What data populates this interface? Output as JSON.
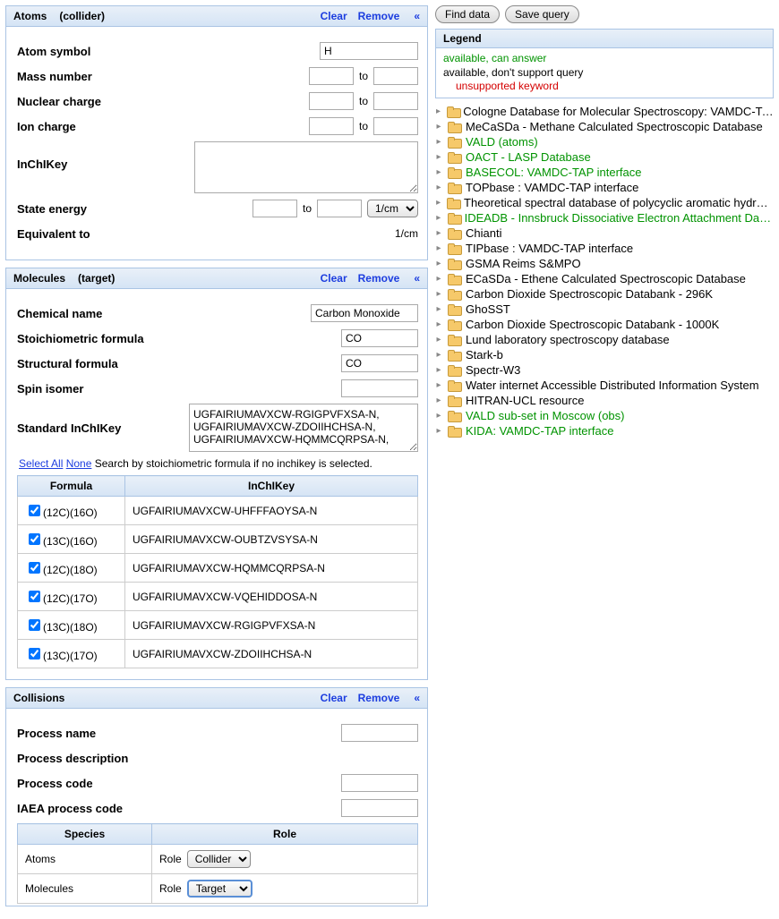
{
  "atoms": {
    "title": "Atoms",
    "subtitle": "(collider)",
    "clear": "Clear",
    "remove": "Remove",
    "collapse_glyph": "«",
    "fields": {
      "symbol_label": "Atom symbol",
      "symbol_value": "H",
      "mass_label": "Mass number",
      "nuclear_label": "Nuclear charge",
      "ion_label": "Ion charge",
      "inchi_label": "InChIKey",
      "state_label": "State energy",
      "to": "to",
      "unit_options": [
        "1/cm"
      ],
      "equivalent_label": "Equivalent to",
      "equivalent_unit": "1/cm"
    }
  },
  "molecules": {
    "title": "Molecules",
    "subtitle": "(target)",
    "clear": "Clear",
    "remove": "Remove",
    "collapse_glyph": "«",
    "fields": {
      "chem_label": "Chemical name",
      "chem_value": "Carbon Monoxide",
      "stoich_label": "Stoichiometric formula",
      "stoich_value": "CO",
      "struct_label": "Structural formula",
      "struct_value": "CO",
      "spin_label": "Spin isomer",
      "std_inchi_label": "Standard InChIKey",
      "std_inchi_value": "UGFAIRIUMAVXCW-RGIGPVFXSA-N,\nUGFAIRIUMAVXCW-ZDOIIHCHSA-N,\nUGFAIRIUMAVXCW-HQMMCQRPSA-N,"
    },
    "select_all": "Select All",
    "none": "None",
    "search_note": "Search by stoichiometric formula if no inchikey is selected.",
    "table_headers": {
      "formula": "Formula",
      "inchi": "InChIKey"
    },
    "isotopes": [
      {
        "checked": true,
        "formula": "(12C)(16O)",
        "inchi": "UGFAIRIUMAVXCW-UHFFFAOYSA-N"
      },
      {
        "checked": true,
        "formula": "(13C)(16O)",
        "inchi": "UGFAIRIUMAVXCW-OUBTZVSYSA-N"
      },
      {
        "checked": true,
        "formula": "(12C)(18O)",
        "inchi": "UGFAIRIUMAVXCW-HQMMCQRPSA-N"
      },
      {
        "checked": true,
        "formula": "(12C)(17O)",
        "inchi": "UGFAIRIUMAVXCW-VQEHIDDOSA-N"
      },
      {
        "checked": true,
        "formula": "(13C)(18O)",
        "inchi": "UGFAIRIUMAVXCW-RGIGPVFXSA-N"
      },
      {
        "checked": true,
        "formula": "(13C)(17O)",
        "inchi": "UGFAIRIUMAVXCW-ZDOIIHCHSA-N"
      }
    ]
  },
  "collisions": {
    "title": "Collisions",
    "clear": "Clear",
    "remove": "Remove",
    "collapse_glyph": "«",
    "fields": {
      "proc_name": "Process name",
      "proc_desc": "Process description",
      "proc_code": "Process code",
      "iaea_code": "IAEA process code"
    },
    "role_table": {
      "species_header": "Species",
      "role_header": "Role",
      "rows": [
        {
          "species": "Atoms",
          "role_label": "Role",
          "role_value": "Collider"
        },
        {
          "species": "Molecules",
          "role_label": "Role",
          "role_value": "Target"
        }
      ],
      "role_options": [
        "Collider",
        "Target"
      ]
    }
  },
  "buttons": {
    "find": "Find data",
    "save": "Save query"
  },
  "legend": {
    "title": "Legend",
    "line1": "available, can answer",
    "line2": "available, don't support query",
    "line3": "unsupported keyword"
  },
  "tree": [
    {
      "label": "Cologne Database for Molecular Spectroscopy: VAMDC-TAP service",
      "available": false
    },
    {
      "label": "MeCaSDa - Methane Calculated Spectroscopic Database",
      "available": false
    },
    {
      "label": "VALD (atoms)",
      "available": true
    },
    {
      "label": "OACT - LASP Database",
      "available": true
    },
    {
      "label": "BASECOL: VAMDC-TAP interface",
      "available": true
    },
    {
      "label": "TOPbase : VAMDC-TAP interface",
      "available": false
    },
    {
      "label": "Theoretical spectral database of polycyclic aromatic hydrocarbons",
      "available": false
    },
    {
      "label": "IDEADB - Innsbruck Dissociative Electron Attachment Database",
      "available": true
    },
    {
      "label": "Chianti",
      "available": false
    },
    {
      "label": "TIPbase : VAMDC-TAP interface",
      "available": false
    },
    {
      "label": "GSMA Reims S&MPO",
      "available": false
    },
    {
      "label": "ECaSDa - Ethene Calculated Spectroscopic Database",
      "available": false
    },
    {
      "label": "Carbon Dioxide Spectroscopic Databank - 296K",
      "available": false
    },
    {
      "label": "GhoSST",
      "available": false
    },
    {
      "label": "Carbon Dioxide Spectroscopic Databank - 1000K",
      "available": false
    },
    {
      "label": "Lund laboratory spectroscopy database",
      "available": false
    },
    {
      "label": "Stark-b",
      "available": false
    },
    {
      "label": "Spectr-W3",
      "available": false
    },
    {
      "label": "Water internet Accessible Distributed Information System",
      "available": false
    },
    {
      "label": "HITRAN-UCL resource",
      "available": false
    },
    {
      "label": "VALD sub-set in Moscow (obs)",
      "available": true
    },
    {
      "label": "KIDA: VAMDC-TAP interface",
      "available": true
    }
  ]
}
